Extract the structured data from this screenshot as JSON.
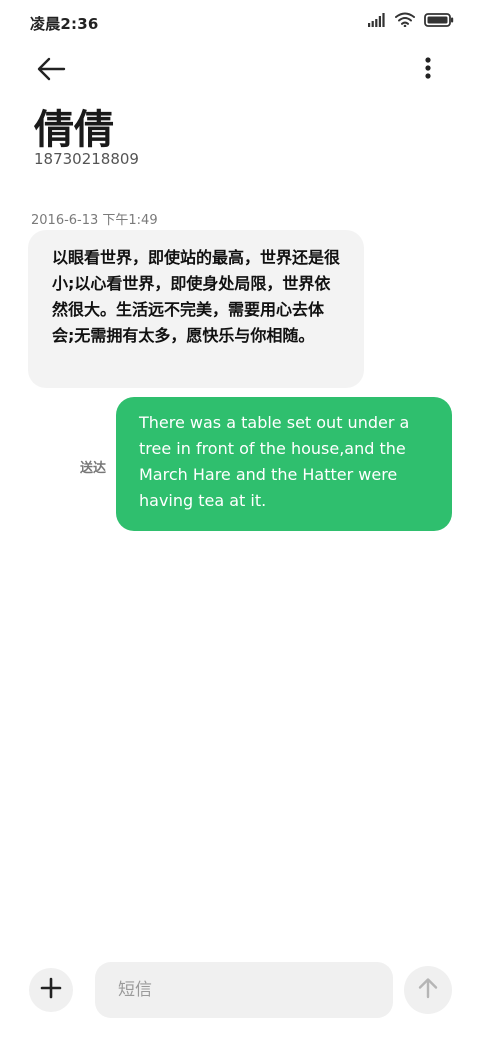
{
  "status_bar": {
    "time": "凌晨2:36",
    "icons": [
      "signal-icon",
      "wifi-icon",
      "battery-icon"
    ]
  },
  "header": {
    "back_icon": "arrow-left-icon",
    "more_icon": "more-vertical-icon",
    "contact_name": "倩倩",
    "contact_number": "18730218809"
  },
  "conversation": {
    "timestamp": "2016-6-13 下午1:49",
    "messages": [
      {
        "direction": "incoming",
        "text": "以眼看世界，即使站的最高，世界还是很小;以心看世界，即使身处局限，世界依然很大。生活远不完美，需要用心去体会;无需拥有太多，愿快乐与你相随。"
      },
      {
        "direction": "outgoing",
        "status": "送达",
        "text": "There was a table set out under a tree in front of the house,and the March Hare and the Hatter were having tea at it."
      }
    ]
  },
  "composer": {
    "add_icon": "plus-icon",
    "placeholder": "短信",
    "value": "",
    "send_icon": "arrow-up-icon"
  },
  "colors": {
    "accent": "#2fbf6e",
    "incoming_bubble": "#f3f3f3",
    "input_background": "#f0f0f0",
    "secondary_text": "#7a7a7a"
  }
}
